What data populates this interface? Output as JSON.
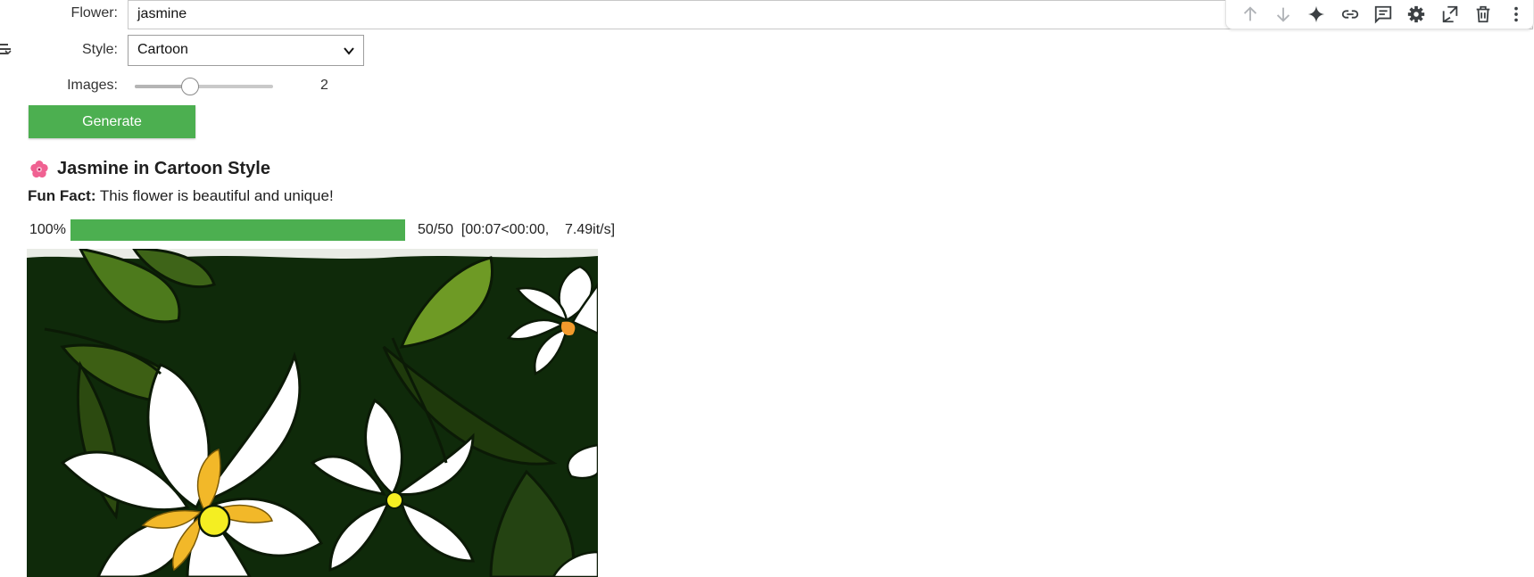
{
  "form": {
    "flower_label": "Flower:",
    "flower_value": "jasmine",
    "style_label": "Style:",
    "style_value": "Cartoon",
    "images_label": "Images:",
    "images_value": "2",
    "images_fraction": 0.4,
    "generate_label": "Generate"
  },
  "result": {
    "heading": "Jasmine in Cartoon Style",
    "fun_fact_label": "Fun Fact:",
    "fun_fact_text": " This flower is beautiful and unique!"
  },
  "progress": {
    "percent_text": "100%",
    "fraction": 1.0,
    "status_text": "50/50  [00:07<00:00,    7.49it/s]"
  },
  "toolbar": {
    "icons": [
      "move-up-icon",
      "move-down-icon",
      "sparkle-icon",
      "link-icon",
      "comment-icon",
      "settings-icon",
      "open-in-tab-icon",
      "delete-icon",
      "more-icon"
    ]
  },
  "colors": {
    "accent_green": "#4caf50",
    "icon_grey": "#3c4043"
  }
}
